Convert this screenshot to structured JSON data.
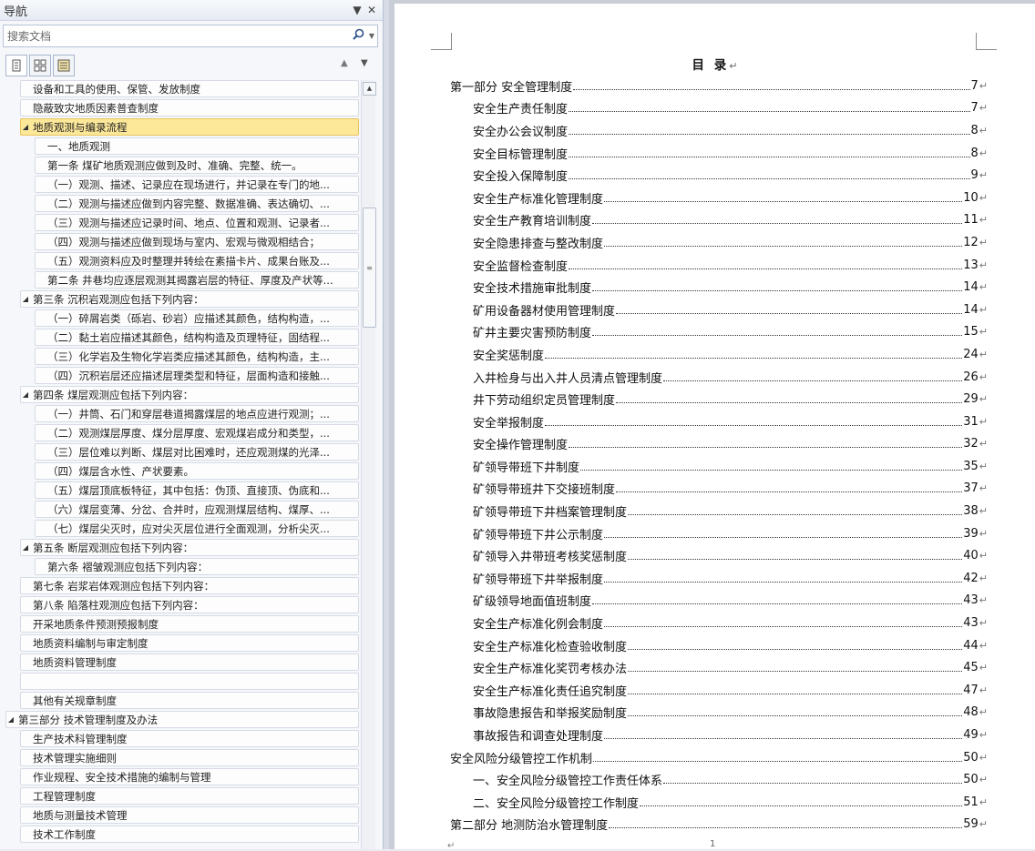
{
  "nav": {
    "title": "导航",
    "search_placeholder": "搜索文档",
    "tree": [
      {
        "label": "设备和工具的使用、保管、发放制度",
        "indent": 1,
        "toggle": "",
        "selected": false
      },
      {
        "label": "隐蔽致灾地质因素普查制度",
        "indent": 1,
        "toggle": "",
        "selected": false
      },
      {
        "label": "地质观测与编录流程",
        "indent": 1,
        "toggle": "◢",
        "selected": true
      },
      {
        "label": "一、地质观测",
        "indent": 2,
        "toggle": "",
        "selected": false
      },
      {
        "label": "第一条  煤矿地质观测应做到及时、准确、完整、统一。",
        "indent": 2,
        "toggle": "",
        "selected": false
      },
      {
        "label": "（一）观测、描述、记录应在现场进行，并记录在专门的地...",
        "indent": 2,
        "toggle": "",
        "selected": false
      },
      {
        "label": "（二）观测与描述应做到内容完整、数据准确、表达确切、...",
        "indent": 2,
        "toggle": "",
        "selected": false
      },
      {
        "label": "（三）观测与描述应记录时间、地点、位置和观测、记录者...",
        "indent": 2,
        "toggle": "",
        "selected": false
      },
      {
        "label": "（四）观测与描述应做到现场与室内、宏观与微观相结合；",
        "indent": 2,
        "toggle": "",
        "selected": false
      },
      {
        "label": "（五）观测资料应及时整理并转绘在素描卡片、成果台账及...",
        "indent": 2,
        "toggle": "",
        "selected": false
      },
      {
        "label": "第二条  井巷均应逐层观测其揭露岩层的特征、厚度及产状等...",
        "indent": 2,
        "toggle": "",
        "selected": false
      },
      {
        "label": "第三条  沉积岩观测应包括下列内容：",
        "indent": 1,
        "toggle": "◢",
        "selected": false
      },
      {
        "label": "（一）碎屑岩类（砾岩、砂岩）应描述其颜色，结构构造，...",
        "indent": 2,
        "toggle": "",
        "selected": false
      },
      {
        "label": "（二）黏土岩应描述其颜色，结构构造及页理特征，固结程...",
        "indent": 2,
        "toggle": "",
        "selected": false
      },
      {
        "label": "（三）化学岩及生物化学岩类应描述其颜色，结构构造，主...",
        "indent": 2,
        "toggle": "",
        "selected": false
      },
      {
        "label": "（四）沉积岩层还应描述层理类型和特征，层面构造和接触...",
        "indent": 2,
        "toggle": "",
        "selected": false
      },
      {
        "label": "第四条  煤层观测应包括下列内容：",
        "indent": 1,
        "toggle": "◢",
        "selected": false
      },
      {
        "label": "（一）井筒、石门和穿层巷道揭露煤层的地点应进行观测；...",
        "indent": 2,
        "toggle": "",
        "selected": false
      },
      {
        "label": "（二）观测煤层厚度、煤分层厚度、宏观煤岩成分和类型，...",
        "indent": 2,
        "toggle": "",
        "selected": false
      },
      {
        "label": "（三）层位难以判断、煤层对比困难时，还应观测煤的光泽...",
        "indent": 2,
        "toggle": "",
        "selected": false
      },
      {
        "label": "（四）煤层含水性、产状要素。",
        "indent": 2,
        "toggle": "",
        "selected": false
      },
      {
        "label": "（五）煤层顶底板特征，其中包括：伪顶、直接顶、伪底和...",
        "indent": 2,
        "toggle": "",
        "selected": false
      },
      {
        "label": "（六）煤层变薄、分岔、合并时，应观测煤层结构、煤厚、...",
        "indent": 2,
        "toggle": "",
        "selected": false
      },
      {
        "label": "（七）煤层尖灭时，应对尖灭层位进行全面观测，分析尖灭...",
        "indent": 2,
        "toggle": "",
        "selected": false
      },
      {
        "label": "第五条  断层观测应包括下列内容：",
        "indent": 1,
        "toggle": "◢",
        "selected": false
      },
      {
        "label": "第六条  褶皱观测应包括下列内容：",
        "indent": 2,
        "toggle": "",
        "selected": false
      },
      {
        "label": "第七条  岩浆岩体观测应包括下列内容：",
        "indent": 1,
        "toggle": "",
        "selected": false
      },
      {
        "label": "第八条 陷落柱观测应包括下列内容：",
        "indent": 1,
        "toggle": "",
        "selected": false
      },
      {
        "label": "开采地质条件预测预报制度",
        "indent": 1,
        "toggle": "",
        "selected": false
      },
      {
        "label": "地质资料编制与审定制度",
        "indent": 1,
        "toggle": "",
        "selected": false
      },
      {
        "label": "地质资料管理制度",
        "indent": 1,
        "toggle": "",
        "selected": false
      },
      {
        "label": "",
        "indent": 1,
        "toggle": "",
        "selected": false
      },
      {
        "label": "其他有关规章制度",
        "indent": 1,
        "toggle": "",
        "selected": false
      },
      {
        "label": "第三部分  技术管理制度及办法",
        "indent": 0,
        "toggle": "◢",
        "selected": false
      },
      {
        "label": "生产技术科管理制度",
        "indent": 1,
        "toggle": "",
        "selected": false
      },
      {
        "label": "技术管理实施细则",
        "indent": 1,
        "toggle": "",
        "selected": false
      },
      {
        "label": " 作业规程、安全技术措施的编制与管理",
        "indent": 1,
        "toggle": "",
        "selected": false
      },
      {
        "label": "工程管理制度",
        "indent": 1,
        "toggle": "",
        "selected": false
      },
      {
        "label": "地质与测量技术管理",
        "indent": 1,
        "toggle": "",
        "selected": false
      },
      {
        "label": "技术工作制度",
        "indent": 1,
        "toggle": "",
        "selected": false
      }
    ]
  },
  "document": {
    "toc_title": "目  录",
    "paragraph_mark": "↵",
    "page_number": "1",
    "page_mark": "↵",
    "toc": [
      {
        "text": "第一部分  安全管理制度",
        "page": "7",
        "level": 1
      },
      {
        "text": "安全生产责任制度",
        "page": "7",
        "level": 2
      },
      {
        "text": "安全办公会议制度",
        "page": "8",
        "level": 2
      },
      {
        "text": "安全目标管理制度",
        "page": "8",
        "level": 2
      },
      {
        "text": "安全投入保障制度",
        "page": "9",
        "level": 2
      },
      {
        "text": "安全生产标准化管理制度",
        "page": "10",
        "level": 2
      },
      {
        "text": "安全生产教育培训制度",
        "page": "11",
        "level": 2
      },
      {
        "text": "安全隐患排查与整改制度",
        "page": "12",
        "level": 2
      },
      {
        "text": "安全监督检查制度",
        "page": "13",
        "level": 2
      },
      {
        "text": "安全技术措施审批制度",
        "page": "14",
        "level": 2
      },
      {
        "text": "矿用设备器材使用管理制度",
        "page": "14",
        "level": 2
      },
      {
        "text": "矿井主要灾害预防制度",
        "page": "15",
        "level": 2
      },
      {
        "text": "安全奖惩制度",
        "page": "24",
        "level": 2
      },
      {
        "text": "入井检身与出入井人员清点管理制度",
        "page": "26",
        "level": 2
      },
      {
        "text": "井下劳动组织定员管理制度",
        "page": "29",
        "level": 2
      },
      {
        "text": "安全举报制度",
        "page": "31",
        "level": 2
      },
      {
        "text": "安全操作管理制度",
        "page": "32",
        "level": 2
      },
      {
        "text": "矿领导带班下井制度",
        "page": "35",
        "level": 2
      },
      {
        "text": "矿领导带班井下交接班制度",
        "page": "37",
        "level": 2
      },
      {
        "text": "矿领导带班下井档案管理制度",
        "page": "38",
        "level": 2
      },
      {
        "text": "矿领导带班下井公示制度",
        "page": "39",
        "level": 2
      },
      {
        "text": "矿领导入井带班考核奖惩制度",
        "page": "40",
        "level": 2
      },
      {
        "text": "矿领导带班下井举报制度",
        "page": "42",
        "level": 2
      },
      {
        "text": "矿级领导地面值班制度",
        "page": "43",
        "level": 2
      },
      {
        "text": "安全生产标准化例会制度",
        "page": "43",
        "level": 2
      },
      {
        "text": "安全生产标准化检查验收制度",
        "page": "44",
        "level": 2
      },
      {
        "text": "安全生产标准化奖罚考核办法",
        "page": "45",
        "level": 2
      },
      {
        "text": "安全生产标准化责任追究制度",
        "page": "47",
        "level": 2
      },
      {
        "text": "事故隐患报告和举报奖励制度",
        "page": "48",
        "level": 2
      },
      {
        "text": "事故报告和调查处理制度",
        "page": "49",
        "level": 2
      },
      {
        "text": "安全风险分级管控工作机制",
        "page": "50",
        "level": 1
      },
      {
        "text": "一、安全风险分级管控工作责任体系",
        "page": "50",
        "level": 2
      },
      {
        "text": "二、安全风险分级管控工作制度",
        "page": "51",
        "level": 2
      },
      {
        "text": "第二部分    地测防治水管理制度",
        "page": "59",
        "level": 1
      }
    ]
  }
}
